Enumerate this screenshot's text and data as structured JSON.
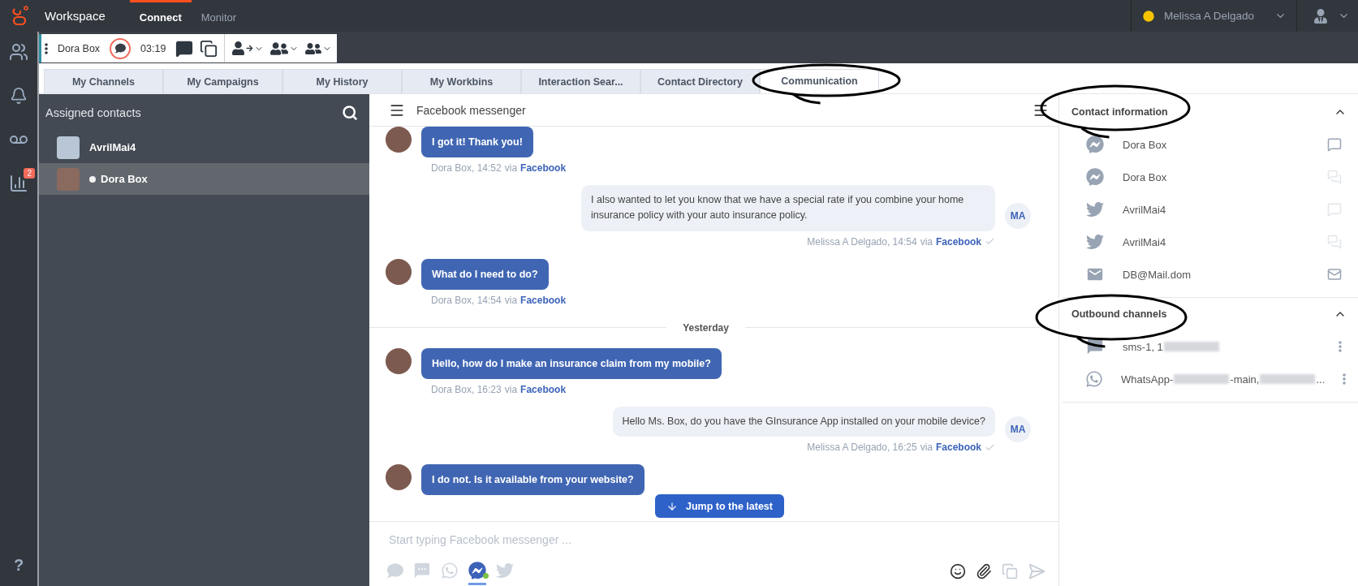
{
  "topbar": {
    "app_name": "Workspace",
    "nav": [
      {
        "label": "Connect",
        "selected": true
      },
      {
        "label": "Monitor",
        "selected": false
      }
    ],
    "user": {
      "name": "Melissa A Delgado"
    }
  },
  "rail": {
    "items": [
      {
        "kind": "contacts"
      },
      {
        "kind": "bell"
      },
      {
        "kind": "voicemail"
      },
      {
        "kind": "reports",
        "badge": "2"
      }
    ],
    "help": "?"
  },
  "interaction": {
    "contact": "Dora Box",
    "timer": "03:19"
  },
  "tabs": [
    {
      "label": "My Channels",
      "selected": false
    },
    {
      "label": "My Campaigns",
      "selected": false
    },
    {
      "label": "My History",
      "selected": false
    },
    {
      "label": "My Workbins",
      "selected": false
    },
    {
      "label": "Interaction Sear...",
      "selected": false
    },
    {
      "label": "Contact Directory",
      "selected": false
    },
    {
      "label": "Communication",
      "selected": true
    }
  ],
  "contacts": {
    "title": "Assigned contacts",
    "items": [
      {
        "name": "AvrilMai4",
        "selected": false,
        "online": false
      },
      {
        "name": "Dora Box",
        "selected": true,
        "online": true
      }
    ]
  },
  "chat": {
    "title": "Facebook messenger",
    "messages": [
      {
        "kind": "incoming",
        "text": "I got it! Thank you!",
        "meta": "Dora Box, 14:52",
        "via": "via",
        "channel": "Facebook"
      },
      {
        "kind": "outgoing",
        "text": "I also wanted to let you know that we have a special rate if you combine your home insurance policy with your auto insurance policy.",
        "meta": "Melissa A Delgado, 14:54",
        "via": "via",
        "channel": "Facebook",
        "initials": "MA"
      },
      {
        "kind": "incoming",
        "text": "What do I need to do?",
        "meta": "Dora Box, 14:54",
        "via": "via",
        "channel": "Facebook"
      },
      {
        "kind": "divider",
        "text": "Yesterday"
      },
      {
        "kind": "incoming",
        "text": "Hello, how do I make an insurance claim from my mobile?",
        "meta": "Dora Box, 16:23",
        "via": "via",
        "channel": "Facebook"
      },
      {
        "kind": "outgoing",
        "text": "Hello Ms. Box, do you have the GInsurance App installed on your mobile device?",
        "meta": "Melissa A Delgado, 16:25",
        "via": "via",
        "channel": "Facebook",
        "initials": "MA"
      },
      {
        "kind": "incoming",
        "text": "I do not. Is it available from your website?"
      }
    ],
    "jump_label": "Jump to the latest",
    "placeholder": "Start typing Facebook messenger ...",
    "channels": [
      {
        "kind": "chat",
        "selected": false
      },
      {
        "kind": "sms",
        "selected": false
      },
      {
        "kind": "whatsapp",
        "selected": false
      },
      {
        "kind": "messenger",
        "selected": true
      },
      {
        "kind": "twitter",
        "selected": false
      }
    ]
  },
  "contact_info": {
    "title": "Contact information",
    "expanded": true,
    "items": [
      {
        "kind": "messenger",
        "value": "Dora Box",
        "action": {
          "kind": "chat",
          "enabled": true
        }
      },
      {
        "kind": "messenger",
        "value": "Dora Box",
        "action": {
          "kind": "chats",
          "enabled": false
        }
      },
      {
        "kind": "twitter",
        "value": "AvrilMai4",
        "action": {
          "kind": "chat",
          "enabled": false
        }
      },
      {
        "kind": "twitter",
        "value": "AvrilMai4",
        "action": {
          "kind": "chats",
          "enabled": false
        }
      },
      {
        "kind": "mail",
        "value": "DB@Mail.dom",
        "action": {
          "kind": "mail",
          "enabled": true
        }
      }
    ]
  },
  "outbound": {
    "title": "Outbound channels",
    "expanded": true,
    "items": [
      {
        "kind": "sms",
        "segments": [
          {
            "kind": "text",
            "text": "sms-1, 1"
          },
          {
            "kind": "redacted"
          }
        ]
      },
      {
        "kind": "whatsapp",
        "segments": [
          {
            "kind": "text",
            "text": "WhatsApp-"
          },
          {
            "kind": "redacted"
          },
          {
            "kind": "text",
            "text": "-main, "
          },
          {
            "kind": "redacted"
          },
          {
            "kind": "text",
            "text": "..."
          }
        ]
      }
    ]
  }
}
